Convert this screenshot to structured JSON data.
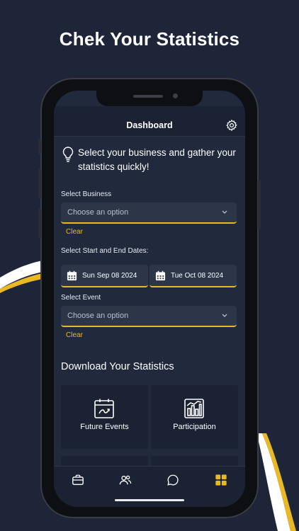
{
  "headline": "Chek Your Statistics",
  "colors": {
    "accent": "#e8b923",
    "background": "#1e2538",
    "card": "#1a2233",
    "field": "#2d3649"
  },
  "topbar": {
    "title": "Dashboard",
    "settings_icon": "gear-icon"
  },
  "intro": {
    "text": "Select your business and gather your statistics quickly!",
    "icon": "lightbulb-icon"
  },
  "business": {
    "label": "Select Business",
    "placeholder": "Choose an option",
    "clear": "Clear"
  },
  "dates": {
    "label": "Select Start and End Dates:",
    "start": "Sun Sep 08 2024",
    "end": "Tue Oct 08 2024"
  },
  "event": {
    "label": "Select Event",
    "placeholder": "Choose an option",
    "clear": "Clear"
  },
  "download": {
    "title": "Download Your Statistics",
    "cards": [
      {
        "label": "Future Events",
        "icon": "calendar-trend-icon"
      },
      {
        "label": "Participation",
        "icon": "bar-chart-icon"
      }
    ]
  },
  "nav": {
    "items": [
      {
        "icon": "briefcase-icon",
        "active": false
      },
      {
        "icon": "users-icon",
        "active": false
      },
      {
        "icon": "chat-icon",
        "active": false
      },
      {
        "icon": "grid-icon",
        "active": true
      }
    ]
  }
}
